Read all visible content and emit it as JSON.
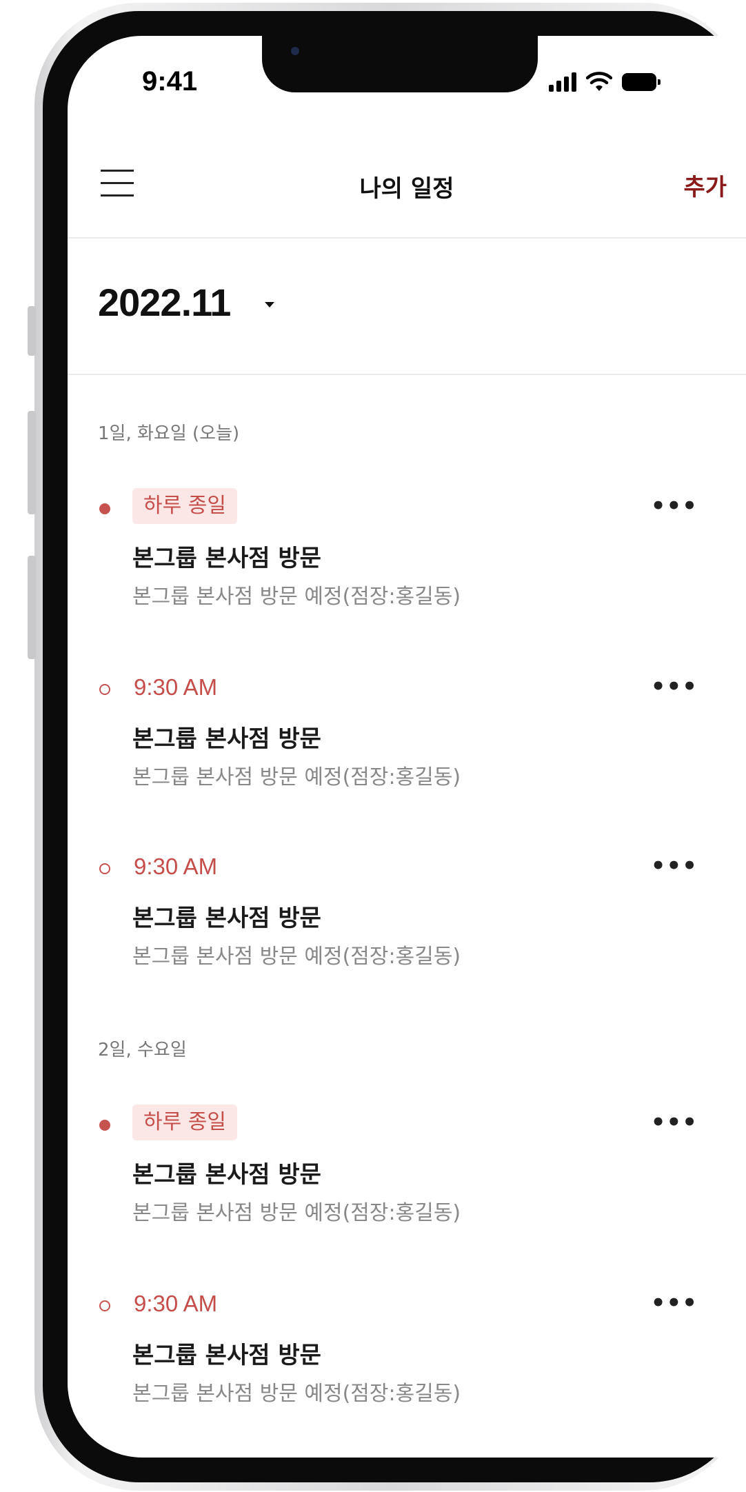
{
  "status": {
    "time": "9:41"
  },
  "navbar": {
    "title": "나의 일정",
    "add_label": "추가"
  },
  "month": {
    "label": "2022.11"
  },
  "days": [
    {
      "header": "1일, 화요일 (오늘)",
      "events": [
        {
          "kind": "all-day",
          "tag": "하루 종일",
          "title": "본그룹 본사점 방문",
          "desc": "본그룹 본사점 방문 예정(점장:홍길동)"
        },
        {
          "kind": "timed",
          "time": "9:30 AM",
          "title": "본그룹 본사점 방문",
          "desc": "본그룹 본사점 방문 예정(점장:홍길동)"
        },
        {
          "kind": "timed",
          "time": "9:30 AM",
          "title": "본그룹 본사점 방문",
          "desc": "본그룹 본사점 방문 예정(점장:홍길동)"
        }
      ]
    },
    {
      "header": "2일, 수요일",
      "events": [
        {
          "kind": "all-day",
          "tag": "하루 종일",
          "title": "본그룹 본사점 방문",
          "desc": "본그룹 본사점 방문 예정(점장:홍길동)"
        },
        {
          "kind": "timed",
          "time": "9:30 AM",
          "title": "본그룹 본사점 방문",
          "desc": "본그룹 본사점 방문 예정(점장:홍길동)"
        }
      ]
    }
  ],
  "colors": {
    "accent": "#c54d4a",
    "add": "#8b1a1a",
    "tag_bg": "#fbe7e6"
  }
}
